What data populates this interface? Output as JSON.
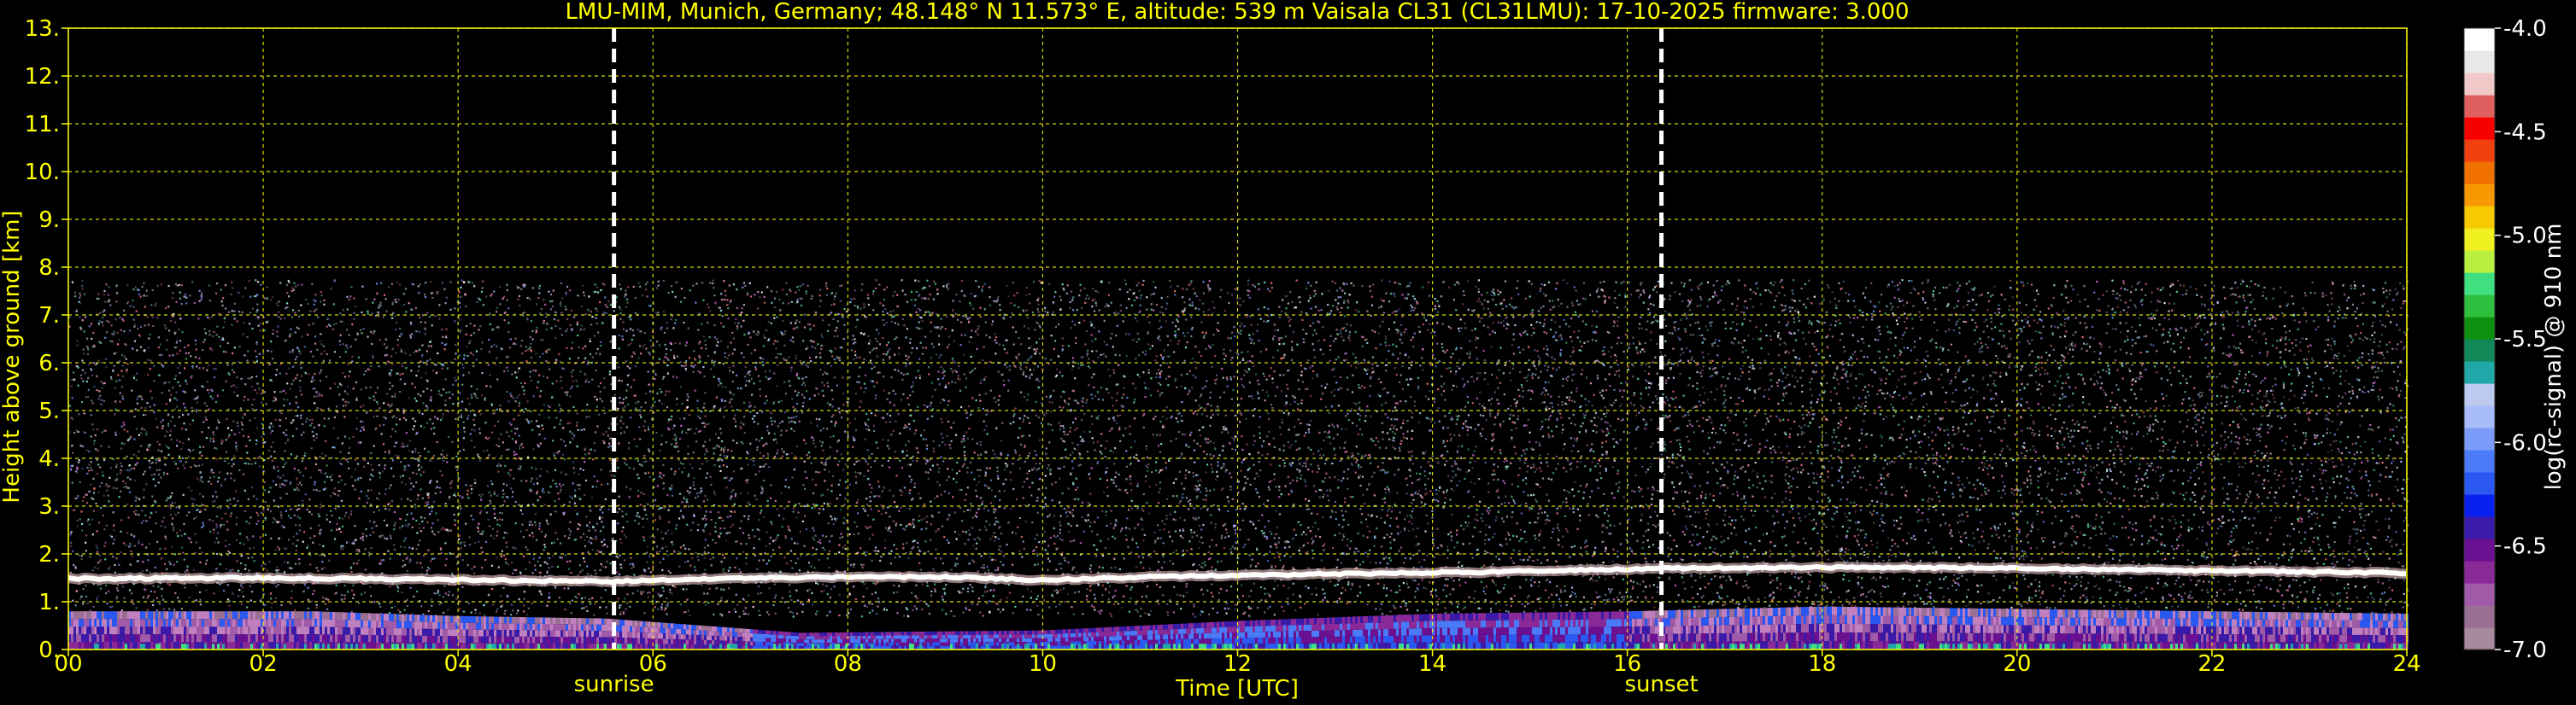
{
  "chart_data": {
    "type": "heatmap",
    "title": "LMU-MIM, Munich, Germany; 48.148° N 11.573° E, altitude: 539 m    Vaisala CL31 (CL31LMU): 17-10-2025    firmware: 3.000",
    "xlabel": "Time [UTC]",
    "ylabel": "Height above ground [km]",
    "xlim": [
      0,
      24
    ],
    "ylim": [
      0,
      13
    ],
    "xticks": [
      0,
      2,
      4,
      6,
      8,
      10,
      12,
      14,
      16,
      18,
      20,
      22,
      24
    ],
    "xtick_labels": [
      "00",
      "02",
      "04",
      "06",
      "08",
      "10",
      "12",
      "14",
      "16",
      "18",
      "20",
      "22",
      "24"
    ],
    "yticks": [
      0,
      1,
      2,
      3,
      4,
      5,
      6,
      7,
      8,
      9,
      10,
      11,
      12,
      13
    ],
    "ytick_labels": [
      "0.",
      "1.",
      "2.",
      "3.",
      "4.",
      "5.",
      "6.",
      "7.",
      "8.",
      "9.",
      "10.",
      "11.",
      "12.",
      "13."
    ],
    "grid": true,
    "markers": [
      {
        "label": "sunrise",
        "x": 5.6
      },
      {
        "label": "sunset",
        "x": 16.35
      }
    ],
    "colorbar": {
      "label": "log(rc-signal) @ 910 nm",
      "range": [
        -7.0,
        -4.0
      ],
      "ticks": [
        -4.0,
        -4.5,
        -5.0,
        -5.5,
        -6.0,
        -6.5,
        -7.0
      ],
      "tick_labels": [
        "-4.0",
        "-4.5",
        "-5.0",
        "-5.5",
        "-6.0",
        "-6.5",
        "-7.0"
      ],
      "colors": [
        "#a88a9e",
        "#9a6f94",
        "#a05aa8",
        "#8a2a98",
        "#6a1090",
        "#3a1aa8",
        "#0a20ee",
        "#2a58f0",
        "#4a7af8",
        "#7a9cf8",
        "#a8bcfc",
        "#bccaf0",
        "#20a8a8",
        "#108858",
        "#109010",
        "#30c040",
        "#40e080",
        "#b8f040",
        "#f0f020",
        "#f8c800",
        "#f89800",
        "#f07000",
        "#f04010",
        "#f80000",
        "#e06060",
        "#f0c8c8",
        "#e8e8e8",
        "#ffffff"
      ]
    },
    "noise_top_km": 7.75,
    "cloud_layer": [
      {
        "t": 0.0,
        "h": 1.48
      },
      {
        "t": 2.0,
        "h": 1.5
      },
      {
        "t": 4.0,
        "h": 1.46
      },
      {
        "t": 5.5,
        "h": 1.42
      },
      {
        "t": 7.0,
        "h": 1.5
      },
      {
        "t": 9.0,
        "h": 1.52
      },
      {
        "t": 10.0,
        "h": 1.45
      },
      {
        "t": 11.0,
        "h": 1.52
      },
      {
        "t": 13.0,
        "h": 1.58
      },
      {
        "t": 14.5,
        "h": 1.62
      },
      {
        "t": 16.4,
        "h": 1.7
      },
      {
        "t": 18.0,
        "h": 1.72
      },
      {
        "t": 20.0,
        "h": 1.7
      },
      {
        "t": 22.0,
        "h": 1.65
      },
      {
        "t": 24.0,
        "h": 1.6
      }
    ],
    "boundary_layer_top": [
      {
        "t": 0.0,
        "h": 0.8
      },
      {
        "t": 2.5,
        "h": 0.8
      },
      {
        "t": 4.0,
        "h": 0.7
      },
      {
        "t": 5.5,
        "h": 0.65
      },
      {
        "t": 7.5,
        "h": 0.35
      },
      {
        "t": 10.0,
        "h": 0.4
      },
      {
        "t": 12.0,
        "h": 0.6
      },
      {
        "t": 14.0,
        "h": 0.75
      },
      {
        "t": 16.0,
        "h": 0.8
      },
      {
        "t": 18.0,
        "h": 0.9
      },
      {
        "t": 20.0,
        "h": 0.85
      },
      {
        "t": 22.0,
        "h": 0.8
      },
      {
        "t": 24.0,
        "h": 0.75
      }
    ]
  }
}
